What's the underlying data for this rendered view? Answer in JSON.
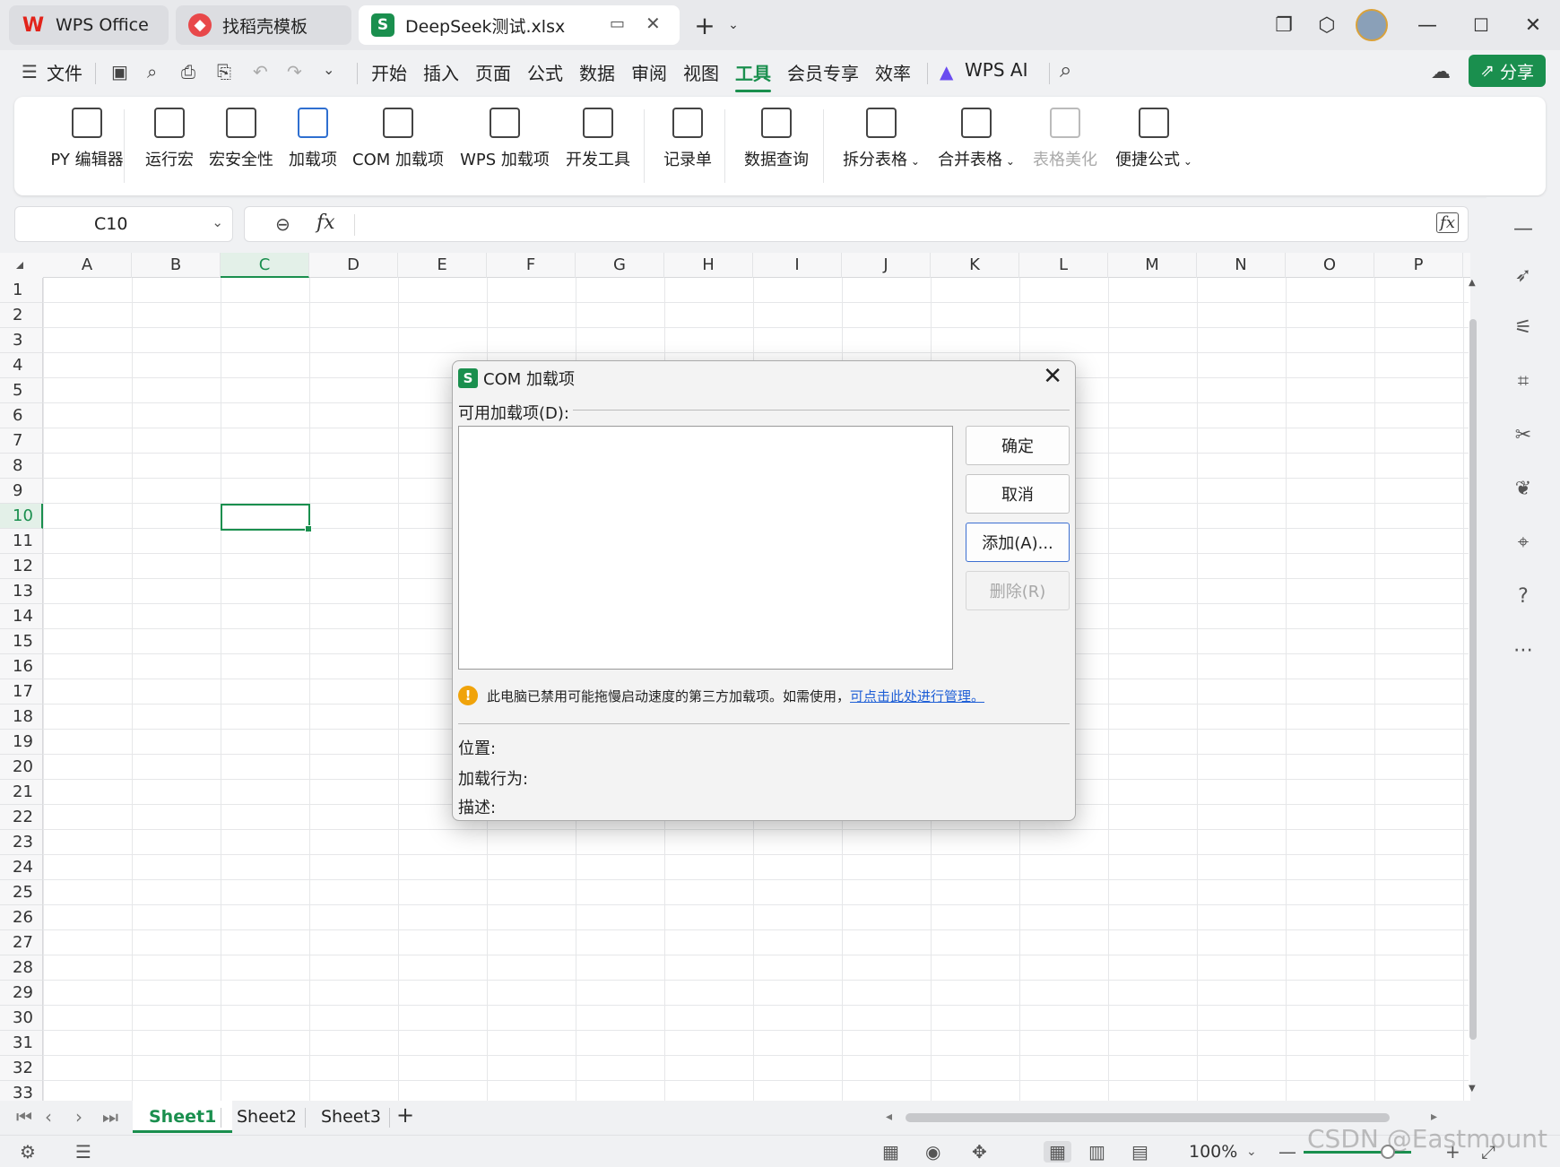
{
  "tabs": [
    {
      "label": "WPS Office",
      "icon": "wps-logo-icon"
    },
    {
      "label": "找稻壳模板",
      "icon": "docer-icon"
    },
    {
      "label": "DeepSeek测试.xlsx",
      "icon": "sheet-icon"
    }
  ],
  "menu": {
    "file_label": "文件",
    "items": [
      "开始",
      "插入",
      "页面",
      "公式",
      "数据",
      "审阅",
      "视图",
      "工具",
      "会员专享",
      "效率"
    ],
    "active": "工具",
    "ai_label": "WPS AI",
    "share_label": "分享"
  },
  "ribbon": {
    "items": [
      {
        "label": "PY 编辑器",
        "icon": "py-editor-icon"
      },
      {
        "label": "运行宏",
        "icon": "run-macro-icon"
      },
      {
        "label": "宏安全性",
        "icon": "macro-security-icon"
      },
      {
        "label": "加载项",
        "icon": "addin-icon"
      },
      {
        "label": "COM 加载项",
        "icon": "com-addin-icon"
      },
      {
        "label": "WPS 加载项",
        "icon": "wps-addin-icon"
      },
      {
        "label": "开发工具",
        "icon": "dev-tools-icon"
      },
      {
        "label": "记录单",
        "icon": "record-form-icon"
      },
      {
        "label": "数据查询",
        "icon": "data-query-icon"
      },
      {
        "label": "拆分表格",
        "icon": "split-table-icon"
      },
      {
        "label": "合并表格",
        "icon": "merge-table-icon"
      },
      {
        "label": "表格美化",
        "icon": "table-beautify-icon"
      },
      {
        "label": "便捷公式",
        "icon": "quick-formula-icon"
      }
    ]
  },
  "formula": {
    "name_box": "C10",
    "fx_label": "fx"
  },
  "grid": {
    "columns": [
      "A",
      "B",
      "C",
      "D",
      "E",
      "F",
      "G",
      "H",
      "I",
      "J",
      "K",
      "L",
      "M",
      "N",
      "O",
      "P"
    ],
    "rows": [
      "1",
      "2",
      "3",
      "4",
      "5",
      "6",
      "7",
      "8",
      "9",
      "10",
      "11",
      "12",
      "13",
      "14",
      "15",
      "16",
      "17",
      "18",
      "19",
      "20",
      "21",
      "22",
      "23",
      "24",
      "25",
      "26",
      "27",
      "28",
      "29",
      "30",
      "31",
      "32",
      "33"
    ],
    "selected_column": "C",
    "selected_row": "10"
  },
  "sheets": {
    "tabs": [
      "Sheet1",
      "Sheet2",
      "Sheet3"
    ],
    "active": "Sheet1",
    "add_label": "+"
  },
  "status": {
    "zoom": "100%"
  },
  "watermark": "CSDN @Eastmount",
  "dialog": {
    "title": "COM 加载项",
    "available_label": "可用加载项(D):",
    "ok_label": "确定",
    "cancel_label": "取消",
    "add_label": "添加(A)...",
    "remove_label": "删除(R)",
    "warning_text": "此电脑已禁用可能拖慢启动速度的第三方加载项。如需使用，",
    "warning_link": "可点击此处进行管理。",
    "location_label": "位置:",
    "load_behavior_label": "加载行为:",
    "description_label": "描述:"
  },
  "colors": {
    "accent": "#1a8f4e",
    "link": "#1f5fd6",
    "warning": "#f0a30a"
  }
}
